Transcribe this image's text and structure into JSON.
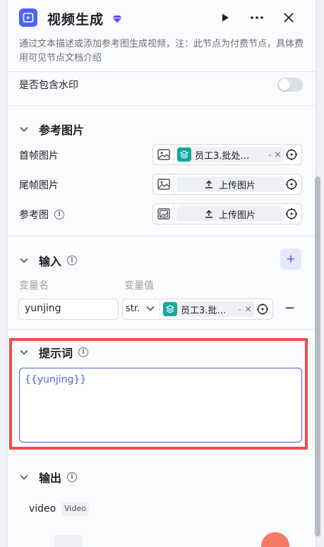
{
  "header": {
    "title": "视频生成",
    "description": "通过文本描述或添加参考图生成视频，注：此节点为付费节点，具体费用可见节点文档介绍"
  },
  "watermark": {
    "label": "是否包含水印",
    "enabled": false
  },
  "reference": {
    "title": "参考图片",
    "first_frame": {
      "label": "首帧图片",
      "value": "员工3.批处…",
      "sep": "-",
      "clear": "×"
    },
    "last_frame": {
      "label": "尾帧图片",
      "button": "上传图片"
    },
    "ref_image": {
      "label": "参考图",
      "button": "上传图片",
      "info": "i"
    }
  },
  "input": {
    "title": "输入",
    "info": "i",
    "col_name": "变量名",
    "col_value": "变量值",
    "rows": [
      {
        "name": "yunjing",
        "type": "str.",
        "value": "员工3.批…",
        "sep": "-",
        "clear": "×",
        "remove": "−"
      }
    ]
  },
  "prompt": {
    "title": "提示词",
    "info": "i",
    "text": "{{yunjing}}"
  },
  "output": {
    "title": "输出",
    "info": "i",
    "items": [
      {
        "name": "video",
        "type": "Video"
      }
    ]
  },
  "colors": {
    "accent": "#4e63f0",
    "highlight": "#f24b4b",
    "chip_icon": "#12a8a0"
  }
}
